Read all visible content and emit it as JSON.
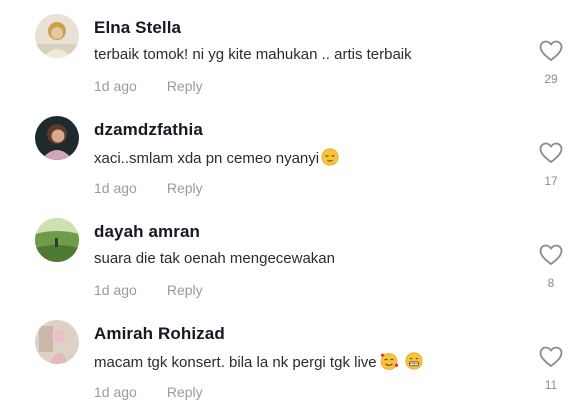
{
  "comments": [
    {
      "username": "Elna Stella",
      "text": "terbaik tomok! ni yg kite mahukan .. artis terbaik",
      "time": "1d ago",
      "reply": "Reply",
      "likes": "29",
      "emojis": []
    },
    {
      "username": "dzamdzfathia",
      "text": "xaci..smlam xda pn cemeo nyanyi",
      "time": "1d ago",
      "reply": "Reply",
      "likes": "17",
      "emojis": [
        "relieved-face-icon"
      ]
    },
    {
      "username": "dayah amran",
      "text": "suara die tak oenah mengecewakan",
      "time": "1d ago",
      "reply": "Reply",
      "likes": "8",
      "emojis": []
    },
    {
      "username": "Amirah Rohizad",
      "text": "macam tgk konsert. bila la nk pergi tgk live",
      "time": "1d ago",
      "reply": "Reply",
      "likes": "11",
      "emojis": [
        "smiling-face-with-hearts-icon",
        "grinning-face-icon"
      ]
    }
  ],
  "colors": {
    "username": "#161823",
    "meta": "#9a9ba0",
    "heart": "#8a8b90"
  }
}
